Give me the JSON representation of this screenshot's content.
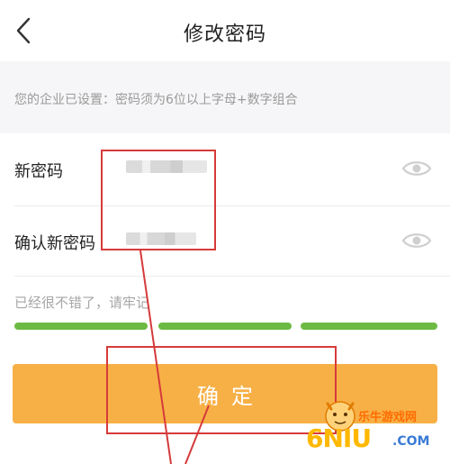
{
  "header": {
    "title": "修改密码",
    "back_icon": "chevron-left-icon"
  },
  "notice": "您的企业已设置：密码须为6位以上字母+数字组合",
  "form": {
    "new_password": {
      "label": "新密码",
      "visibility_icon": "eye-icon"
    },
    "confirm_password": {
      "label": "确认新密码",
      "visibility_icon": "eye-icon"
    }
  },
  "strength": {
    "hint": "已经很不错了，请牢记",
    "level": 3,
    "max_level": 3,
    "color": "#6cba43"
  },
  "confirm_button": {
    "label": "确定",
    "color": "#f7b046"
  },
  "annotation_color": "#d63a3a",
  "watermark": {
    "site_name": "乐牛游戏网",
    "logo_text": "6NIU",
    "domain_suffix": ".COM"
  }
}
